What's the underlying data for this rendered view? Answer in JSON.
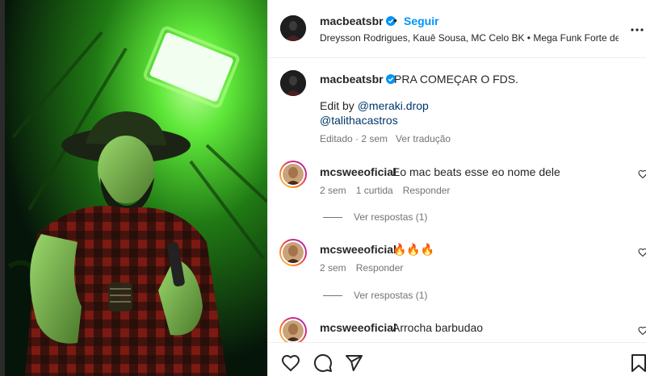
{
  "post": {
    "username": "macbeatsbr",
    "follow_label": "Seguir",
    "dot": "•",
    "audio": "Dreysson Rodrigues, Kauê Sousa, MC Celo BK • Mega Funk Forte de L..."
  },
  "caption": {
    "username": "macbeatsbr",
    "text": "PRA COMEÇAR O FDS.",
    "edit_prefix": "Edit by ",
    "mention1": "@meraki.drop",
    "mention2": "@talithacastros",
    "edited": "Editado · 2 sem",
    "see_translation": "Ver tradução"
  },
  "comments": [
    {
      "username": "mcsweeoficial",
      "text": "Eo mac beats esse eo nome dele",
      "time": "2 sem",
      "likes": "1 curtida",
      "reply": "Responder",
      "view_replies": "Ver respostas (1)"
    },
    {
      "username": "mcsweeoficial",
      "text": "🔥🔥🔥",
      "time": "2 sem",
      "reply": "Responder",
      "view_replies": "Ver respostas (1)"
    },
    {
      "username": "mcsweeoficial",
      "text": "Arrocha barbudao"
    }
  ],
  "icons": {
    "more": "more-horizontal-icon",
    "like": "heart-icon",
    "comment": "comment-icon",
    "share": "send-icon",
    "save": "bookmark-icon",
    "verified": "verified-badge-icon"
  },
  "colors": {
    "accent": "#0095f6",
    "verified": "#0095f6",
    "mention": "#00376b",
    "muted": "#737373",
    "stage_green": "#5cff3a"
  }
}
